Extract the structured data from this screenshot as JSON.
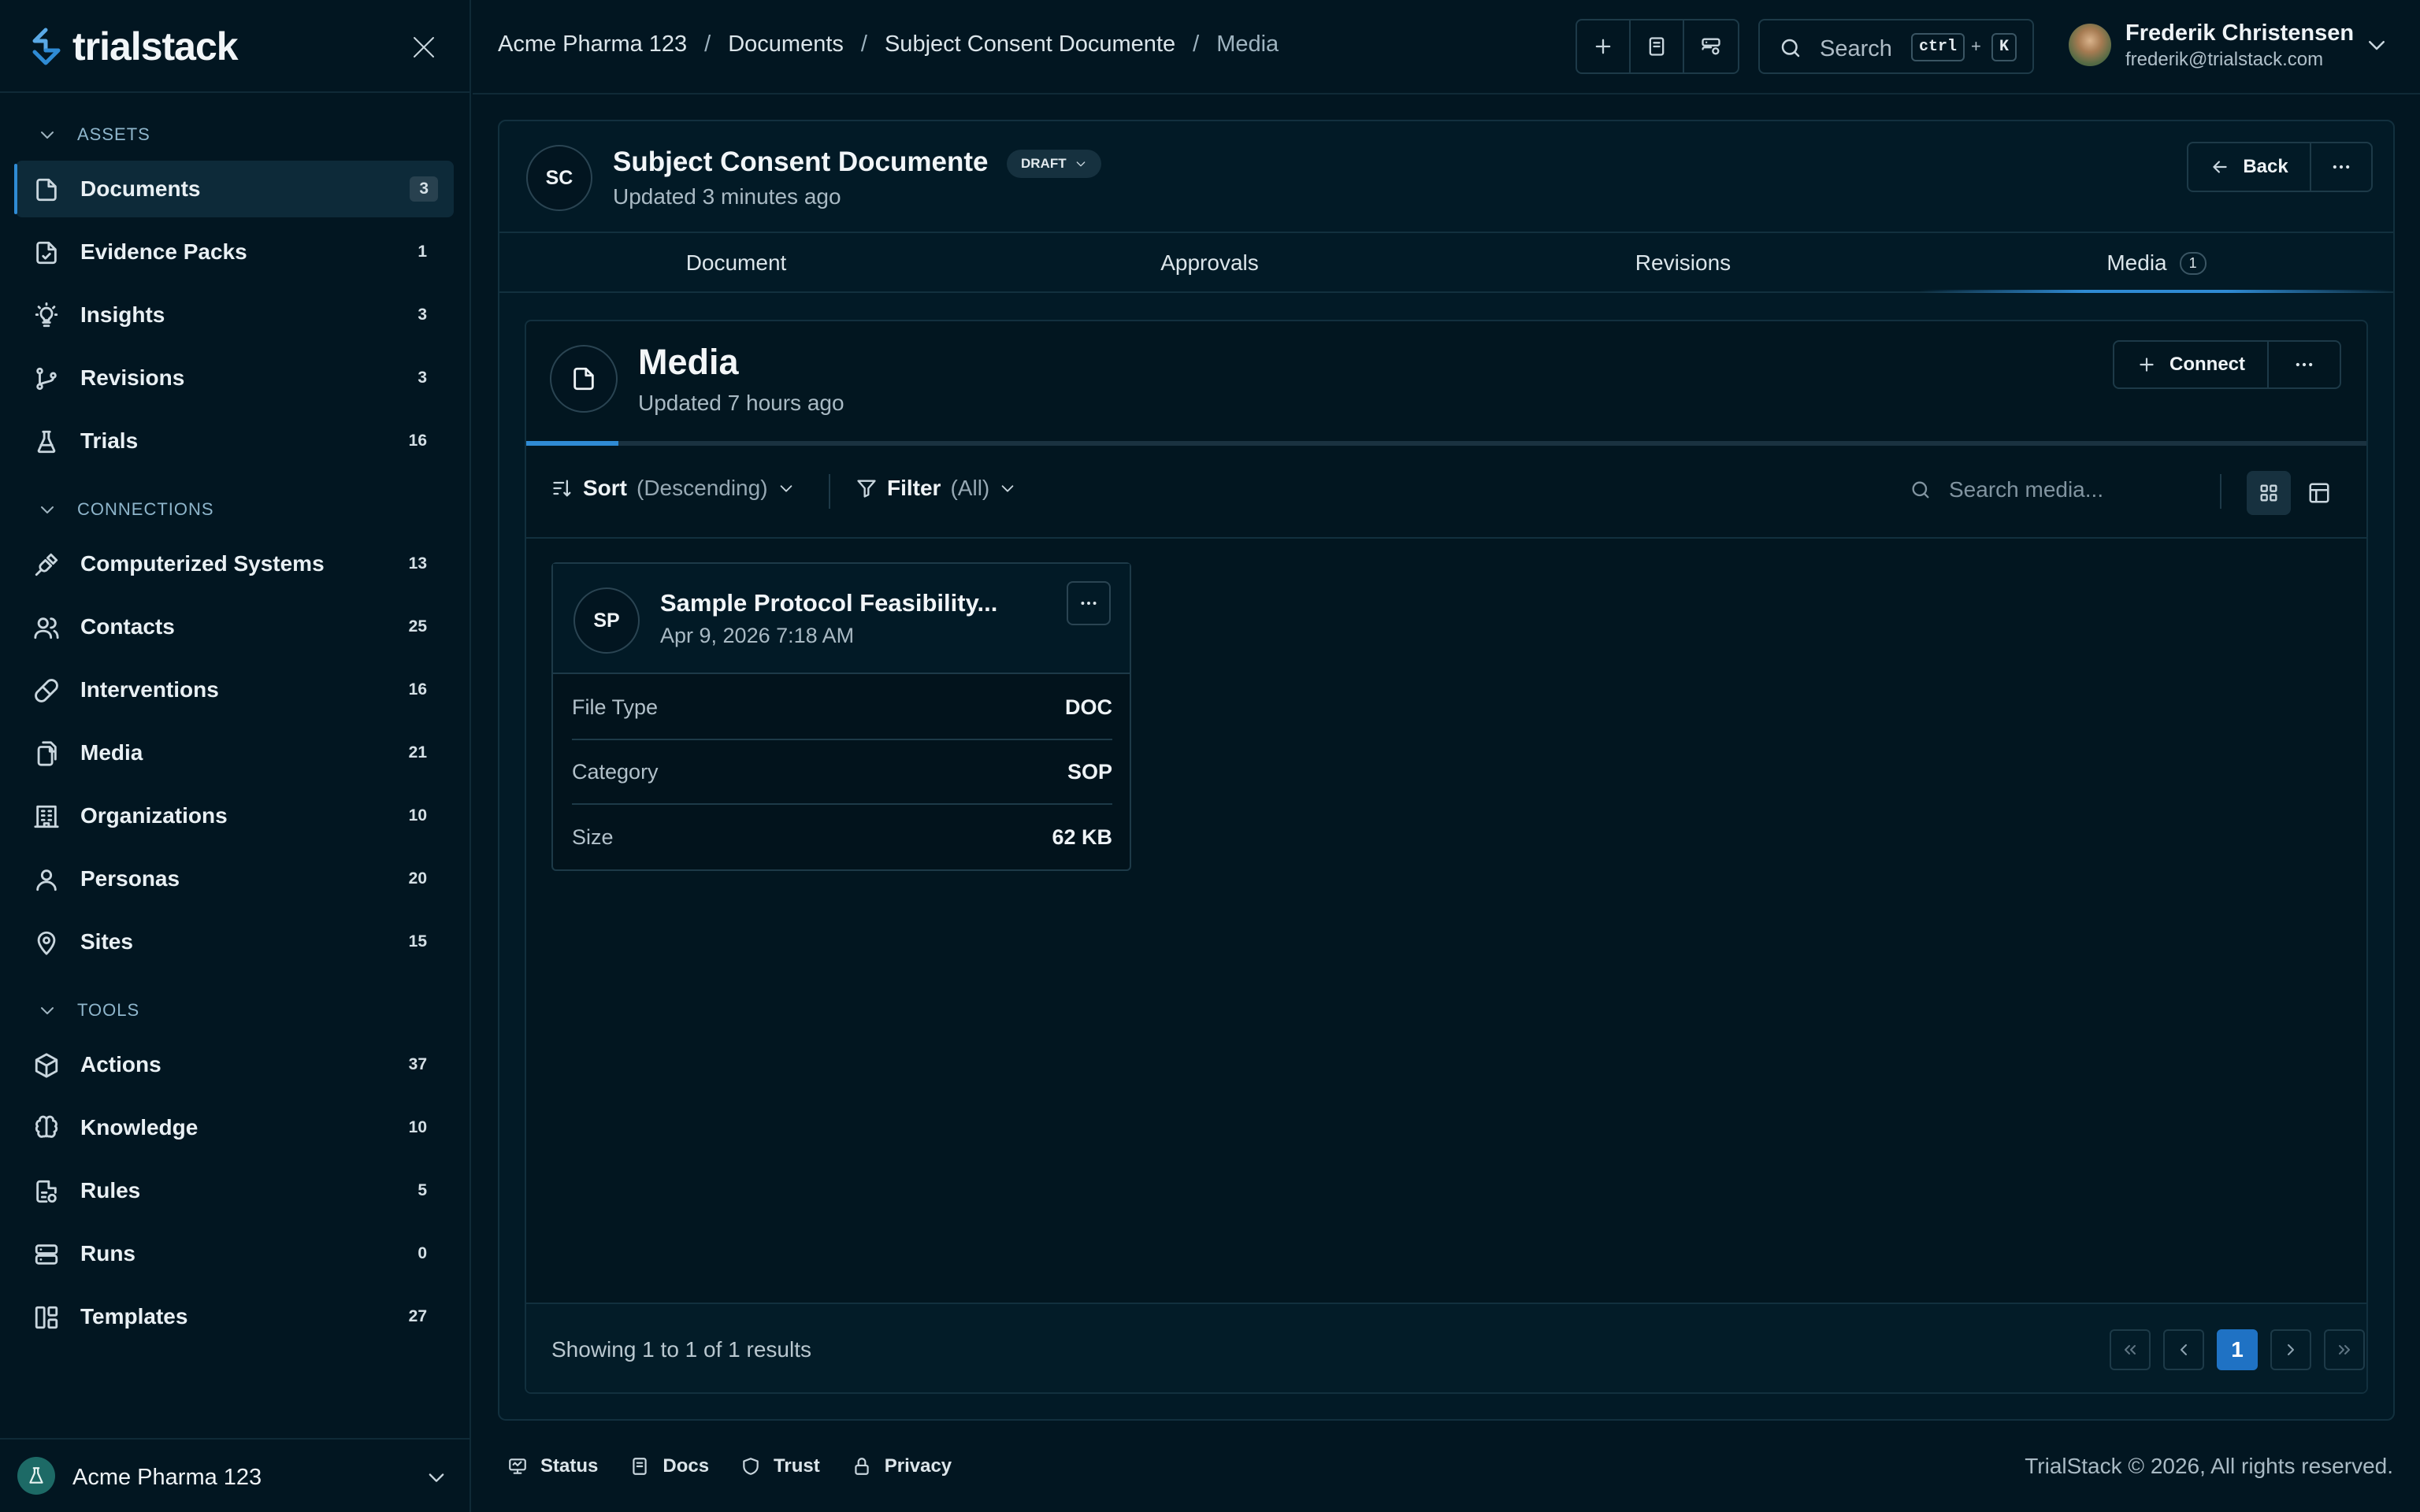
{
  "app": {
    "logo_text": "trialstack"
  },
  "sidebar": {
    "sections": [
      {
        "label": "ASSETS"
      },
      {
        "label": "CONNECTIONS"
      },
      {
        "label": "TOOLS"
      }
    ],
    "items": [
      {
        "label": "Documents",
        "count": "3",
        "icon": "document-icon",
        "active": true
      },
      {
        "label": "Evidence Packs",
        "count": "1",
        "icon": "file-check-icon"
      },
      {
        "label": "Insights",
        "count": "3",
        "icon": "lightbulb-icon"
      },
      {
        "label": "Revisions",
        "count": "3",
        "icon": "git-branch-icon"
      },
      {
        "label": "Trials",
        "count": "16",
        "icon": "flask-icon"
      },
      {
        "label": "Computerized Systems",
        "count": "13",
        "icon": "plug-icon"
      },
      {
        "label": "Contacts",
        "count": "25",
        "icon": "users-icon"
      },
      {
        "label": "Interventions",
        "count": "16",
        "icon": "pill-icon"
      },
      {
        "label": "Media",
        "count": "21",
        "icon": "files-icon"
      },
      {
        "label": "Organizations",
        "count": "10",
        "icon": "building-icon"
      },
      {
        "label": "Personas",
        "count": "20",
        "icon": "user-icon"
      },
      {
        "label": "Sites",
        "count": "15",
        "icon": "map-pin-icon"
      },
      {
        "label": "Actions",
        "count": "37",
        "icon": "box-icon"
      },
      {
        "label": "Knowledge",
        "count": "10",
        "icon": "brain-icon"
      },
      {
        "label": "Rules",
        "count": "5",
        "icon": "file-rules-icon"
      },
      {
        "label": "Runs",
        "count": "0",
        "icon": "server-icon"
      },
      {
        "label": "Templates",
        "count": "27",
        "icon": "layout-icon"
      }
    ],
    "org_name": "Acme Pharma 123"
  },
  "topbar": {
    "breadcrumbs": [
      "Acme Pharma 123",
      "Documents",
      "Subject Consent Documente",
      "Media"
    ],
    "search_label": "Search",
    "shortcut_ctrl": "ctrl",
    "shortcut_plus": "+",
    "shortcut_key": "K",
    "user_name": "Frederik Christensen",
    "user_email": "frederik@trialstack.com"
  },
  "document": {
    "avatar": "SC",
    "title": "Subject Consent Documente",
    "status": "DRAFT",
    "updated": "Updated 3 minutes ago",
    "back_label": "Back"
  },
  "tabs": [
    {
      "label": "Document"
    },
    {
      "label": "Approvals"
    },
    {
      "label": "Revisions"
    },
    {
      "label": "Media",
      "count": "1"
    }
  ],
  "media": {
    "title": "Media",
    "updated": "Updated 7 hours ago",
    "connect_label": "Connect",
    "progress_fraction": 0.05,
    "sort_label": "Sort",
    "sort_value": "(Descending)",
    "filter_label": "Filter",
    "filter_value": "(All)",
    "search_placeholder": "Search media...",
    "items": [
      {
        "avatar": "SP",
        "title": "Sample Protocol Feasibility...",
        "date": "Apr 9, 2026 7:18 AM",
        "props": [
          {
            "label": "File Type",
            "value": "DOC"
          },
          {
            "label": "Category",
            "value": "SOP"
          },
          {
            "label": "Size",
            "value": "62 KB"
          }
        ]
      }
    ],
    "results_text": "Showing 1 to 1 of 1 results",
    "current_page": "1"
  },
  "footer": {
    "links": [
      {
        "label": "Status",
        "icon": "monitor-icon"
      },
      {
        "label": "Docs",
        "icon": "book-icon"
      },
      {
        "label": "Trust",
        "icon": "shield-icon"
      },
      {
        "label": "Privacy",
        "icon": "lock-icon"
      }
    ],
    "copyright": "TrialStack © 2026, All rights reserved."
  },
  "colors": {
    "accent": "#2f8bd4",
    "background": "#021621",
    "page_button": "#1f72c4"
  }
}
